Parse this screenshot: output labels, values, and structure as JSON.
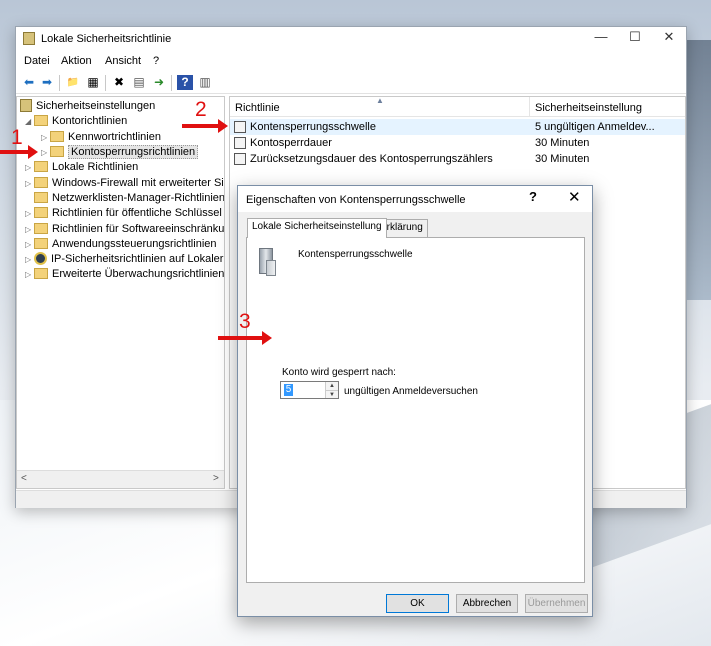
{
  "window": {
    "title": "Lokale Sicherheitsrichtlinie",
    "controls": {
      "minimize": "—",
      "maximize": "☐",
      "close": "✕"
    }
  },
  "menu": [
    "Datei",
    "Aktion",
    "Ansicht",
    "?"
  ],
  "toolbar": {
    "icons": [
      "back-icon",
      "forward-icon",
      "up-folder-icon",
      "show-tree-icon",
      "delete-icon",
      "properties-icon",
      "export-icon",
      "help-icon",
      "console-icon"
    ],
    "glyphs": [
      "⬅",
      "➡",
      "📁",
      "▦",
      "✖",
      "▤",
      "➜",
      "?",
      "▥"
    ]
  },
  "tree": {
    "root": "Sicherheitseinstellungen",
    "items": [
      {
        "label": "Kontorichtlinien",
        "expanded": true
      },
      {
        "label": "Kennwortrichtlinien"
      },
      {
        "label": "Kontosperrungsrichtlinien",
        "selected": true
      },
      {
        "label": "Lokale Richtlinien"
      },
      {
        "label": "Windows-Firewall mit erweiterter Sich"
      },
      {
        "label": "Netzwerklisten-Manager-Richtlinien"
      },
      {
        "label": "Richtlinien für öffentliche Schlüssel"
      },
      {
        "label": "Richtlinien für Softwareeinschränkung"
      },
      {
        "label": "Anwendungssteuerungsrichtlinien"
      },
      {
        "label": "IP-Sicherheitsrichtlinien auf Lokaler C"
      },
      {
        "label": "Erweiterte Überwachungsrichtlinienko"
      }
    ],
    "scroll_left": "<",
    "scroll_right": ">"
  },
  "list": {
    "columns": [
      "Richtlinie",
      "Sicherheitseinstellung"
    ],
    "rows": [
      {
        "name": "Kontensperrungsschwelle",
        "value": "5 ungültigen Anmeldev...",
        "selected": true
      },
      {
        "name": "Kontosperrdauer",
        "value": "30 Minuten"
      },
      {
        "name": "Zurücksetzungsdauer des Kontosperrungszählers",
        "value": "30 Minuten"
      }
    ]
  },
  "dialog": {
    "title": "Eigenschaften von Kontensperrungsschwelle",
    "help": "?",
    "close": "✕",
    "tabs": [
      "Lokale Sicherheitseinstellung",
      "Erklärung"
    ],
    "heading": "Kontensperrungsschwelle",
    "field_label": "Konto wird gesperrt nach:",
    "field_value": "5",
    "field_suffix": "ungültigen Anmeldeversuchen",
    "buttons": {
      "ok": "OK",
      "cancel": "Abbrechen",
      "apply": "Übernehmen"
    }
  },
  "annotations": [
    "1",
    "2",
    "3"
  ],
  "colors": {
    "annotation": "#e01010",
    "selection": "#e5f3ff",
    "accent": "#0078d7"
  }
}
